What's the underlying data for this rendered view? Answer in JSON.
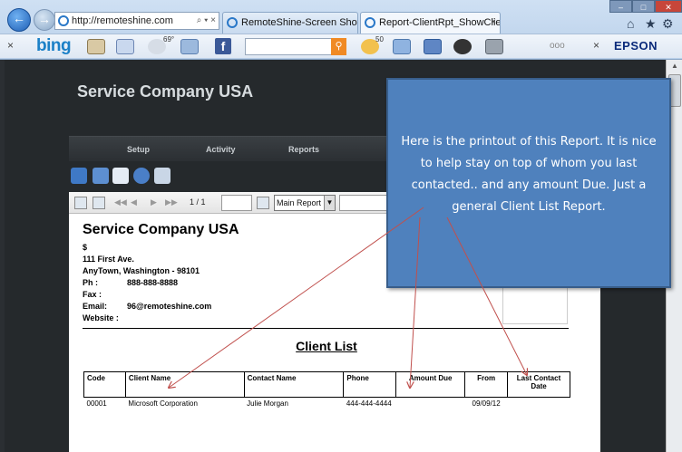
{
  "browser": {
    "address": "http://remoteshine.com",
    "address_tools": "⌕ ▾ ×",
    "tabs": [
      {
        "label": "RemoteShine-Screen Shots"
      },
      {
        "label": "Report-ClientRpt_ShowClie..."
      }
    ],
    "tab_close": "×"
  },
  "toolbar": {
    "close": "×",
    "bing": "bing",
    "weather_temp": "69°",
    "count": "50",
    "more": "ooo",
    "close2": "×",
    "epson": "EPSON"
  },
  "site": {
    "title": "Service Company USA",
    "nav": [
      "Setup",
      "Activity",
      "Reports"
    ]
  },
  "viewer": {
    "page_indicator": "1 / 1",
    "report_select": "Main Report"
  },
  "report": {
    "company": "Service Company USA",
    "currency": "$",
    "address1": "111 First Ave.",
    "address2": "AnyTown, Washington - 98101",
    "ph_label": "Ph :",
    "ph": "888-888-8888",
    "fax_label": "Fax :",
    "email_label": "Email:",
    "email": "96@remoteshine.com",
    "website_label": "Website :",
    "title": "Client List",
    "columns": [
      "Code",
      "Client Name",
      "Contact Name",
      "Phone",
      "Amount Due",
      "From",
      "Last Contact Date"
    ],
    "rows": [
      [
        "00001",
        "Microsoft Corporation",
        "Julie Morgan",
        "444-444-4444",
        "",
        "09/09/12",
        ""
      ]
    ]
  },
  "callout": {
    "text": "Here is the printout of this Report. It is nice to help stay on top of whom you last contacted.. and any amount Due. Just a general Client List Report.",
    "color": "#4f81bd"
  }
}
